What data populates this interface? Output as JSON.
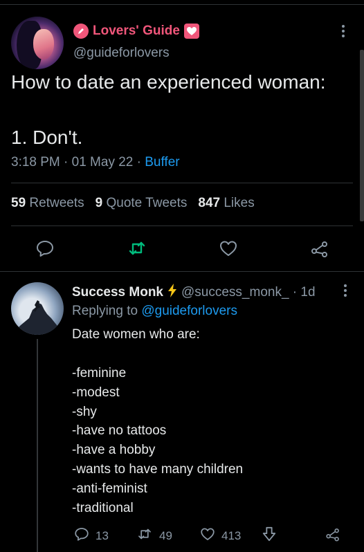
{
  "tweet": {
    "display_name": "Lovers' Guide",
    "handle": "@guideforlovers",
    "text_line1": "How to date an experienced woman:",
    "text_line2": "1. Don't.",
    "time": "3:18 PM · 01 May 22 · ",
    "source": "Buffer",
    "retweets_count": "59",
    "retweets_label": "Retweets",
    "quotes_count": "9",
    "quotes_label": "Quote Tweets",
    "likes_count": "847",
    "likes_label": "Likes"
  },
  "reply": {
    "display_name": "Success Monk",
    "handle_time": "@success_monk_ · 1d",
    "replying_prefix": "Replying to ",
    "replying_mention": "@guideforlovers",
    "lines": [
      "Date women who are:",
      "",
      "-feminine",
      "-modest",
      "-shy",
      "-have no tattoos",
      "-have a hobby",
      "-wants to have many children",
      "-anti-feminist",
      "-traditional"
    ],
    "reply_count": "13",
    "retweet_count": "49",
    "like_count": "413"
  },
  "colors": {
    "accent_pink": "#f0567a",
    "link_blue": "#1d9bf0",
    "retweet_green": "#00ba7c",
    "muted": "#8b98a5"
  }
}
